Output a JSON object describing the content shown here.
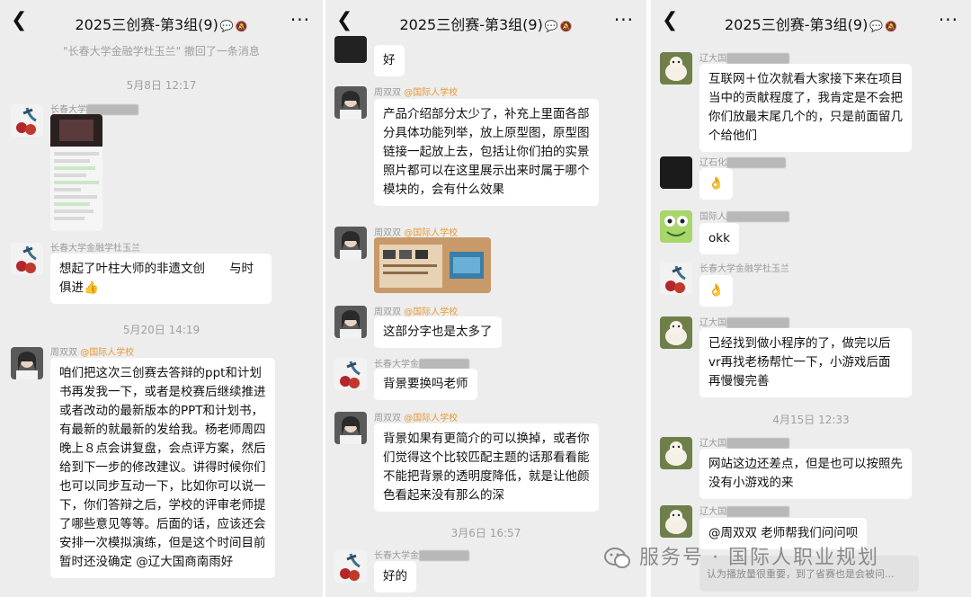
{
  "header": {
    "title": "2025三创赛-第3组(9)",
    "back_icon": "chevron-left",
    "more_label": "···"
  },
  "panel1": {
    "sys_msg": "\"长春大学金融学杜玉兰\" 撤回了一条消息",
    "time1": "5月8日 12:17",
    "m1_name": "长春大学",
    "m2_name": "长春大学金融学杜玉兰",
    "m2_text": "想起了叶柱大师的非遗文创　　与时俱进👍",
    "time2": "5月20日 14:19",
    "m3_name": "周双双",
    "m3_tag": "@国际人学校",
    "m3_text": "咱们把这次三创赛去答辩的ppt和计划书再发我一下，或者是校赛后继续推进或者改动的最新版本的PPT和计划书，有最新的就最新的发给我。杨老师周四晚上８点会讲复盘，会点评方案，然后给到下一步的修改建议。讲得时候你们也可以同步互动一下，比如你可以说一下，你们答辩之后，学校的评审老师提了哪些意见等等。后面的话，应该还会安排一次模拟演练，但是这个时间目前暂时还没确定 @辽大国商南雨好"
  },
  "panel2": {
    "m1_text": "好",
    "m2_name": "周双双",
    "m2_tag": "@国际人学校",
    "m2_text": "产品介绍部分太少了，补充上里面各部分具体功能列举，放上原型图，原型图链接一起放上去，包括让你们拍的实景照片都可以在这里展示出来时属于哪个模块的，会有什么效果",
    "m3_name": "周双双",
    "m3_tag": "@国际人学校",
    "m4_name": "周双双",
    "m4_tag": "@国际人学校",
    "m4_text": "这部分字也是太多了",
    "m5_name": "长春大学金",
    "m5_text": "背景要换吗老师",
    "m6_name": "周双双",
    "m6_tag": "@国际人学校",
    "m6_text": "背景如果有更简介的可以换掉，或者你们觉得这个比较匹配主题的话那看看能不能把背景的透明度降低，就是让他颜色看起来没有那么的深",
    "time1": "3月6日 16:57",
    "m7_name": "长春大学金",
    "m7_text": "好的"
  },
  "panel3": {
    "m1_name": "辽大国",
    "m1_text": "互联网＋位次就看大家接下来在项目当中的贡献程度了，我肯定是不会把你们放最末尾几个的，只是前面留几个给他们",
    "m2_name": "辽石化",
    "m2_text": "👌",
    "m3_name": "国际人",
    "m3_text": "okk",
    "m4_name": "长春大学金融学杜玉兰",
    "m4_text": "👌",
    "m5_name": "辽大国",
    "m5_text": "已经找到做小程序的了，做完以后vr再找老杨帮忙一下，小游戏后面再慢慢完善",
    "time1": "4月15日 12:33",
    "m6_name": "辽大国",
    "m6_text": "网站这边还差点，但是也可以按照先没有小游戏的来",
    "m7_name": "辽大国",
    "m7_text": "@周双双 老师帮我们问问呗",
    "quote_text": "认为播放量很重要，到了省赛也是会被问..."
  },
  "watermark": "服务号 · 国际人职业规划"
}
